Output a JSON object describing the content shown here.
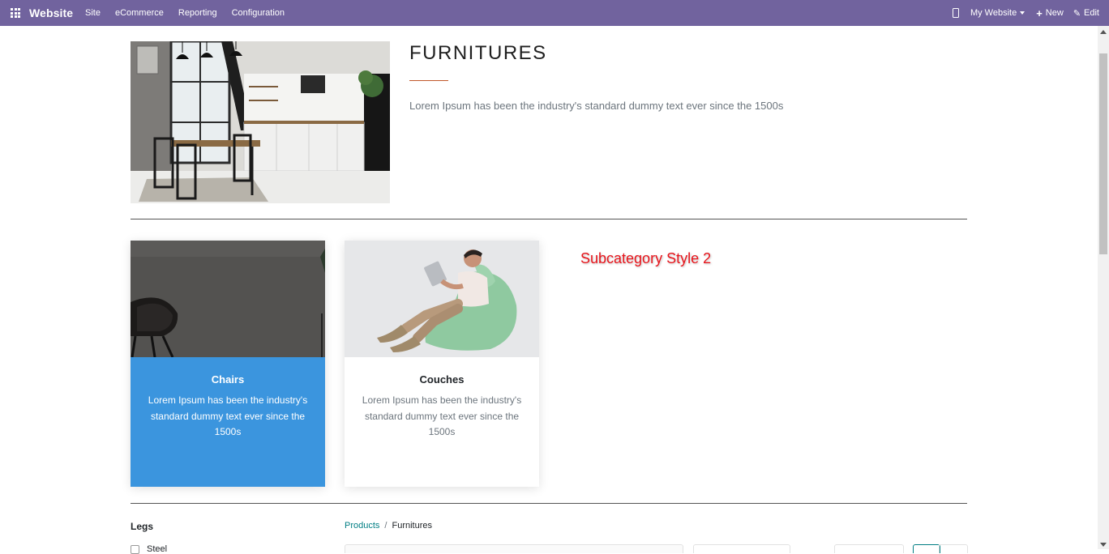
{
  "navbar": {
    "brand": "Website",
    "menu": [
      "Site",
      "eCommerce",
      "Reporting",
      "Configuration"
    ],
    "website_selector": "My Website",
    "new_label": "New",
    "edit_label": "Edit",
    "bg_color": "#71639e"
  },
  "category": {
    "title": "FURNITURES",
    "description": "Lorem Ipsum has been the industry's standard dummy text ever since the 1500s"
  },
  "subcategories": [
    {
      "name": "Chairs",
      "description": "Lorem Ipsum has been the industry's standard dummy text ever since the 1500s",
      "highlight_color": "#3b95de"
    },
    {
      "name": "Couches",
      "description": "Lorem Ipsum has been the industry's standard dummy text ever since the 1500s"
    }
  ],
  "annotation": "Subcategory Style 2",
  "filters": {
    "group_title": "Legs",
    "first_option": "Steel"
  },
  "breadcrumb": {
    "root": "Products",
    "separator": "/",
    "current": "Furnitures"
  }
}
